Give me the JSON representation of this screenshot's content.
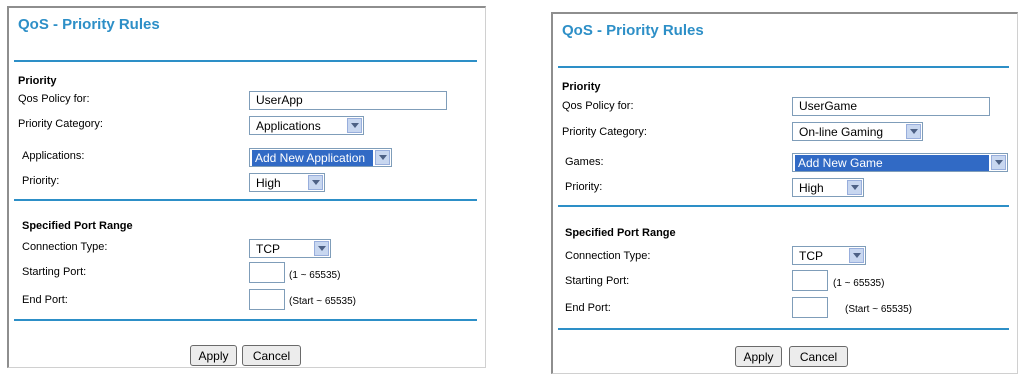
{
  "panels": [
    {
      "title": "QoS - Priority Rules",
      "priority_section": "Priority",
      "policy_label": "Qos Policy for:",
      "policy_value": "UserApp",
      "category_label": "Priority Category:",
      "category_value": "Applications",
      "item_label": "Applications:",
      "item_value": "Add New Application",
      "priority_label": "Priority:",
      "priority_value": "High",
      "port_section": "Specified Port Range",
      "connection_label": "Connection Type:",
      "connection_value": "TCP",
      "start_label": "Starting Port:",
      "start_value": "",
      "start_hint": "(1 ~ 65535)",
      "end_label": "End Port:",
      "end_value": "",
      "end_hint": "(Start ~ 65535)",
      "apply_label": "Apply",
      "cancel_label": "Cancel"
    },
    {
      "title": "QoS - Priority Rules",
      "priority_section": "Priority",
      "policy_label": "Qos Policy for:",
      "policy_value": "UserGame",
      "category_label": "Priority Category:",
      "category_value": "On-line Gaming",
      "item_label": "Games:",
      "item_value": "Add New Game",
      "priority_label": "Priority:",
      "priority_value": "High",
      "port_section": "Specified Port Range",
      "connection_label": "Connection Type:",
      "connection_value": "TCP",
      "start_label": "Starting Port:",
      "start_value": "",
      "start_hint": "(1 ~ 65535)",
      "end_label": "End Port:",
      "end_value": "",
      "end_hint": "(Start ~ 65535)",
      "apply_label": "Apply",
      "cancel_label": "Cancel"
    }
  ],
  "colors": {
    "title": "#2d8fc7",
    "divider": "#2d8fc7",
    "selection_highlight": "#316ac5"
  },
  "icons": {
    "dropdown": "chevron-down-icon"
  }
}
